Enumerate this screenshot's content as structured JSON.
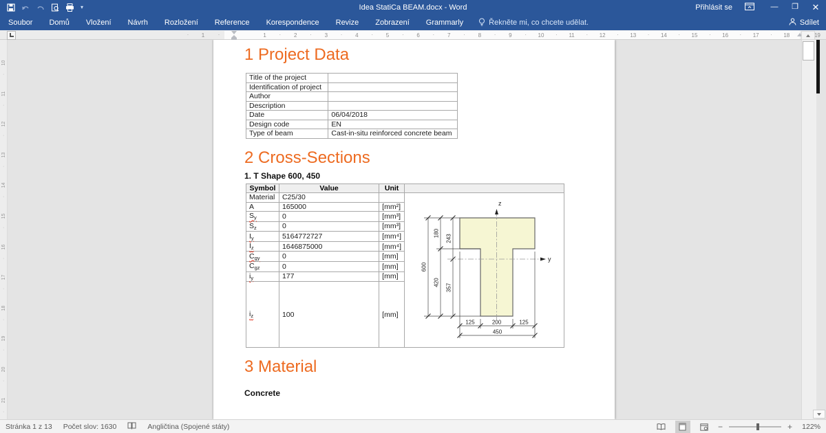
{
  "window": {
    "title": "Idea StatiCa BEAM.docx - Word",
    "sign_in": "Přihlásit se",
    "share": "Sdílet",
    "controls": {
      "minimize": "—",
      "restore": "❐",
      "close": "✕"
    }
  },
  "ribbon": {
    "tabs": [
      "Soubor",
      "Domů",
      "Vložení",
      "Návrh",
      "Rozložení",
      "Reference",
      "Korespondence",
      "Revize",
      "Zobrazení",
      "Grammarly"
    ],
    "tell_me": "Řekněte mi, co chcete udělat."
  },
  "ruler": {
    "horizontal_numbers": [
      "1",
      "2",
      "3",
      "4",
      "5",
      "6",
      "7",
      "8",
      "9",
      "10",
      "11",
      "12",
      "13",
      "14",
      "15",
      "16",
      "17",
      "18",
      "19"
    ],
    "margin_number": "1",
    "vertical_numbers": [
      "10",
      "11",
      "12",
      "13",
      "14",
      "15",
      "16",
      "17",
      "18",
      "19",
      "20",
      "21"
    ]
  },
  "document": {
    "section1": {
      "heading": "1 Project Data"
    },
    "project_table": [
      {
        "label": "Title of the project",
        "value": ""
      },
      {
        "label": "Identification of project",
        "value": ""
      },
      {
        "label": "Author",
        "value": ""
      },
      {
        "label": "Description",
        "value": ""
      },
      {
        "label": "Date",
        "value": "06/04/2018"
      },
      {
        "label": "Design code",
        "value": "EN"
      },
      {
        "label": "Type of beam",
        "value": "Cast-in-situ reinforced concrete beam"
      }
    ],
    "section2": {
      "heading": "2 Cross-Sections",
      "subheading": "1. T Shape 600, 450"
    },
    "cross_section_table": {
      "headers": [
        "Symbol",
        "Value",
        "Unit"
      ],
      "rows": [
        {
          "symbol": "Material",
          "value": "C25/30",
          "unit": "",
          "misspelled": false,
          "tall": false
        },
        {
          "symbol": "A",
          "value": "165000",
          "unit": "[mm²]",
          "misspelled": false,
          "tall": false
        },
        {
          "symbol": "S_y",
          "value": "0",
          "unit": "[mm³]",
          "misspelled": true,
          "tall": false
        },
        {
          "symbol": "S_z",
          "value": "0",
          "unit": "[mm³]",
          "misspelled": false,
          "tall": false
        },
        {
          "symbol": "I_y",
          "value": "5164772727",
          "unit": "[mm⁴]",
          "misspelled": true,
          "tall": false
        },
        {
          "symbol": "I_z",
          "value": "1646875000",
          "unit": "[mm⁴]",
          "misspelled": true,
          "tall": false
        },
        {
          "symbol": "C_gy",
          "value": "0",
          "unit": "[mm]",
          "misspelled": true,
          "tall": false
        },
        {
          "symbol": "C_gz",
          "value": "0",
          "unit": "[mm]",
          "misspelled": false,
          "tall": false
        },
        {
          "symbol": "i_y",
          "value": "177",
          "unit": "[mm]",
          "misspelled": true,
          "tall": false
        },
        {
          "symbol": "i_z",
          "value": "100",
          "unit": "[mm]",
          "misspelled": true,
          "tall": true
        }
      ]
    },
    "section3": {
      "heading": "3 Material",
      "subheading": "Concrete"
    }
  },
  "diagram": {
    "type": "cross-section",
    "shape": "T",
    "fill": "#f6f6d3",
    "axes": {
      "vertical": "z",
      "horizontal": "y"
    },
    "dimensions_mm": {
      "total_height": "600",
      "flange_height": "180",
      "height_below_flange": "420",
      "height_above_centroid": "243",
      "height_below_centroid": "357",
      "flange_overhang_left": "125",
      "web_width": "200",
      "flange_overhang_right": "125",
      "total_width": "450"
    }
  },
  "status_bar": {
    "page": "Stránka 1 z 13",
    "word_count": "Počet slov: 1630",
    "language": "Angličtina (Spojené státy)",
    "zoom_level": "122%",
    "zoom_minus": "−",
    "zoom_plus": "+"
  },
  "colors": {
    "titlebar": "#2b579a",
    "heading": "#ed6b21",
    "shape_fill": "#f6f6d3"
  }
}
